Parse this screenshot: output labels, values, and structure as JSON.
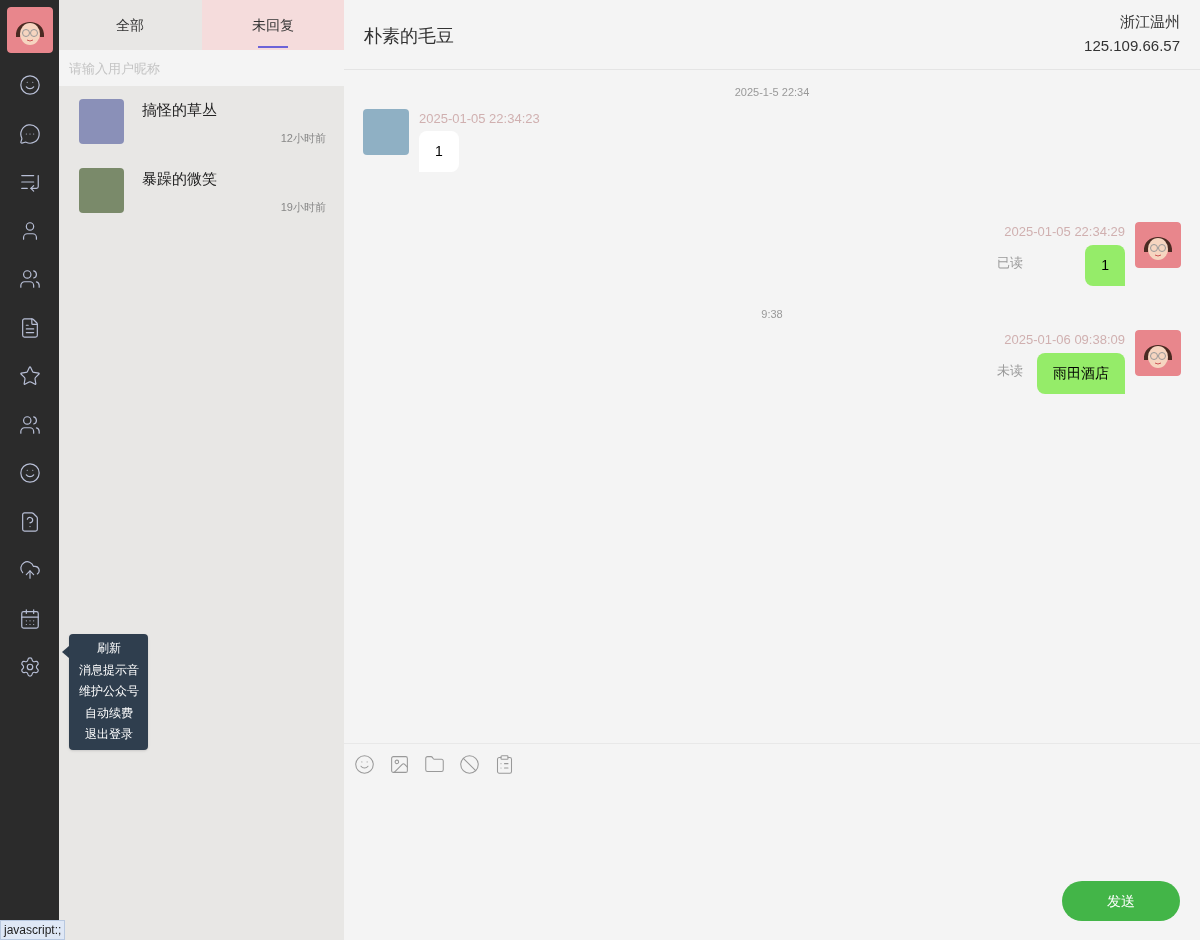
{
  "rail": {
    "items": [
      {
        "kind": "smile-bubble"
      },
      {
        "kind": "chat"
      },
      {
        "kind": "list"
      },
      {
        "kind": "user"
      },
      {
        "kind": "users"
      },
      {
        "kind": "doc"
      },
      {
        "kind": "star"
      },
      {
        "kind": "users"
      },
      {
        "kind": "smile"
      },
      {
        "kind": "help"
      },
      {
        "kind": "upload"
      },
      {
        "kind": "calendar"
      },
      {
        "kind": "settings"
      }
    ]
  },
  "settings_menu": {
    "items": [
      "刷新",
      "消息提示音",
      "维护公众号",
      "自动续费",
      "退出登录"
    ]
  },
  "tabs": [
    {
      "label": "全部",
      "selected": false
    },
    {
      "label": "未回复",
      "selected": true
    }
  ],
  "search": {
    "placeholder": "请输入用户昵称"
  },
  "conversations": [
    {
      "name": "搞怪的草丛",
      "time": "12小时前"
    },
    {
      "name": "暴躁的微笑",
      "time": "19小时前"
    }
  ],
  "chat": {
    "title": "朴素的毛豆",
    "location": "浙江温州",
    "ip": "125.109.66.57"
  },
  "messages": [
    {
      "kind": "time",
      "text": "2025-1-5 22:34"
    },
    {
      "kind": "incoming",
      "timestamp": "2025-01-05 22:34:23",
      "text": "1"
    },
    {
      "kind": "outgoing",
      "timestamp": "2025-01-05 22:34:29",
      "text": "1",
      "status": "已读"
    },
    {
      "kind": "time",
      "text": "9:38"
    },
    {
      "kind": "outgoing",
      "timestamp": "2025-01-06 09:38:09",
      "text": "雨田酒店",
      "status": "未读"
    }
  ],
  "composer": {
    "tools": [
      {
        "kind": "emoji"
      },
      {
        "kind": "image"
      },
      {
        "kind": "folder"
      },
      {
        "kind": "block"
      },
      {
        "kind": "schedule"
      }
    ],
    "send": "发送"
  },
  "status_bar": "javascript:;"
}
